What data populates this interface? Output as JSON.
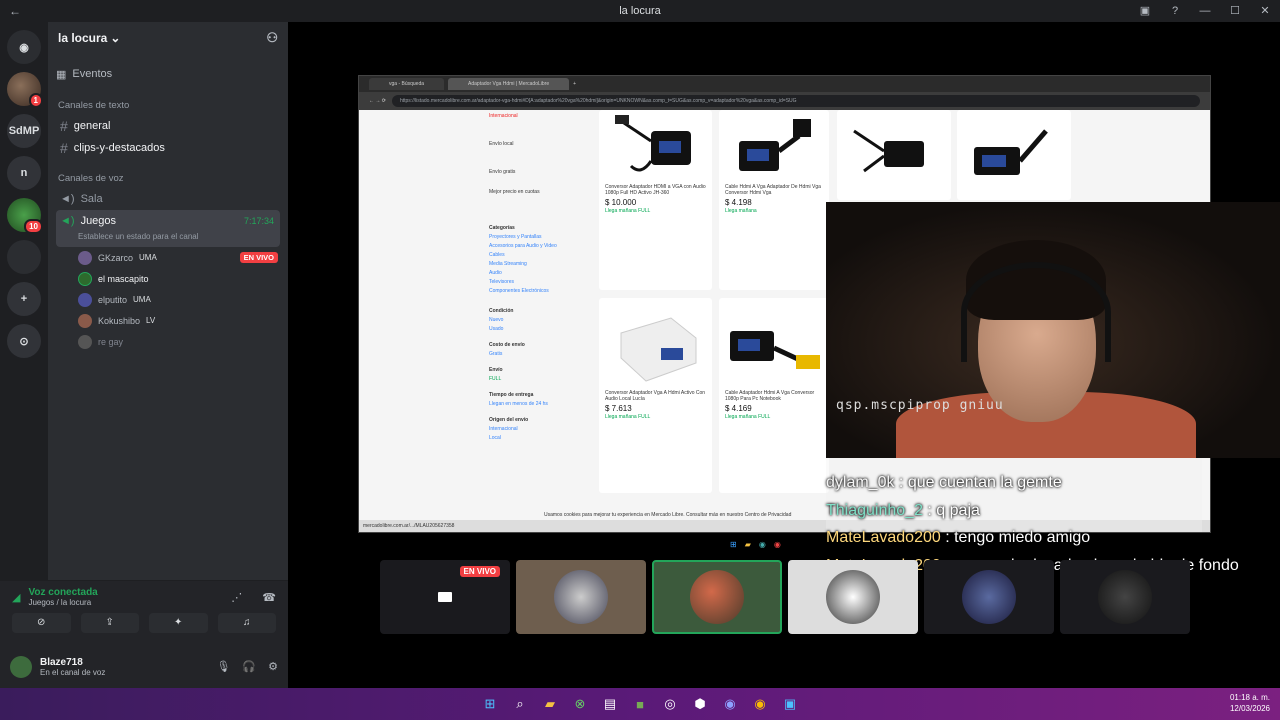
{
  "titlebar": {
    "title": "la locura"
  },
  "server_list": {
    "items": [
      "SdMP",
      "n"
    ],
    "badges": [
      "1",
      "10"
    ]
  },
  "guild": {
    "name": "la locura"
  },
  "events": {
    "label": "Eventos"
  },
  "text_category": {
    "label": "Canales de texto"
  },
  "text_channels": [
    "general",
    "clips-y-destacados"
  ],
  "voice_category": {
    "label": "Canales de voz"
  },
  "voice_channels": {
    "sala": "Sala",
    "juegos": "Juegos",
    "juegos_time": "7:17:34",
    "juegos_status": "Establece un estado para el canal"
  },
  "voice_users": [
    {
      "name": "GKzarco",
      "tag": "UMA",
      "live": "EN VIVO"
    },
    {
      "name": "el mascapito",
      "tag": ""
    },
    {
      "name": "elputito",
      "tag": "UMA"
    },
    {
      "name": "Kokushibo",
      "tag": "LV"
    },
    {
      "name": "re gay",
      "tag": ""
    }
  ],
  "voice_panel": {
    "status": "Voz conectada",
    "location": "Juegos / la locura"
  },
  "user_panel": {
    "name": "Blaze718",
    "status": "En el canal de voz"
  },
  "browser": {
    "tab1": "vga - Búsqueda",
    "tab2": "Adaptador Vga Hdmi | MercadoLibre",
    "url": "https://listado.mercadolibre.com.ar/adaptador-vga-hdmi#D[A:adaptador%20vga%20hdmi]&origin=UNKNOWN&as.comp_t=SUG&as.comp_v=adaptador%20vga&as.comp_id=SUG",
    "status_url": "mercadolibre.com.ar/.../MLAU205627358",
    "cookie_text": "Usamos cookies para mejorar tu experiencia en Mercado Libre. Consultar más en nuestro Centro de Privacidad"
  },
  "filters": {
    "internacional": "Internacional",
    "envio_local": "Envío local",
    "envio_gratis": "Envío gratis",
    "mejor_precio": "Mejor precio en cuotas",
    "categorias": "Categorías",
    "cat_items": [
      "Proyectores y Pantallas",
      "Accesorios para Audio y Video",
      "Cables",
      "Media Streaming",
      "Audio",
      "Televisores",
      "Componentes Electrónicos"
    ],
    "condicion": "Condición",
    "cond_items": [
      "Nuevo",
      "Usado"
    ],
    "costo": "Costo de envío",
    "costo_items": [
      "Gratis"
    ],
    "envio": "Envío",
    "envio_items": [
      "FULL"
    ],
    "tiempo": "Tiempo de entrega",
    "tiempo_items": [
      "Llegan en menos de 24 hs"
    ],
    "origen": "Origen del envío",
    "origen_items": [
      "Internacional",
      "Local"
    ]
  },
  "products": [
    {
      "name": "Conversor Adaptador HDMI a VGA con Audio 1080p Full HD Activo JH-360",
      "price": "$ 10.000",
      "ship": "Llega mañana FULL"
    },
    {
      "name": "Cable Hdmi A Vga Adaptador De Hdmi Vga Conversor Hdmi Vga",
      "price": "$ 4.198",
      "ship": "Llega mañana"
    },
    {
      "name": "Conversor Adaptador Vga A Hdmi Activo Con Audio Local Lucía",
      "price": "$ 7.613",
      "ship": "Llega mañana FULL"
    },
    {
      "name": "Cable Adaptador Hdmi A Vga Conversor 1080p Para Pc Notebook",
      "price": "$ 4.169",
      "ship": "Llega mañana FULL"
    }
  ],
  "webcam": {
    "overlay_text": "qsp.mscpiprop gniuu"
  },
  "chat": [
    {
      "user": "dylam_0k",
      "text": " : que cuentan la gemte"
    },
    {
      "user": "Thiaguinho_2",
      "text": " : q paja"
    },
    {
      "user": "MateLavado200",
      "text": " : tengo miedo amigo"
    },
    {
      "user": "MateLavado200",
      "text": " : muy mal educado el que habla de fondo"
    }
  ],
  "tiles": {
    "live": "EN VIVO"
  },
  "clock": {
    "time": "01:18 a. m.",
    "date": "12/03/2026"
  }
}
